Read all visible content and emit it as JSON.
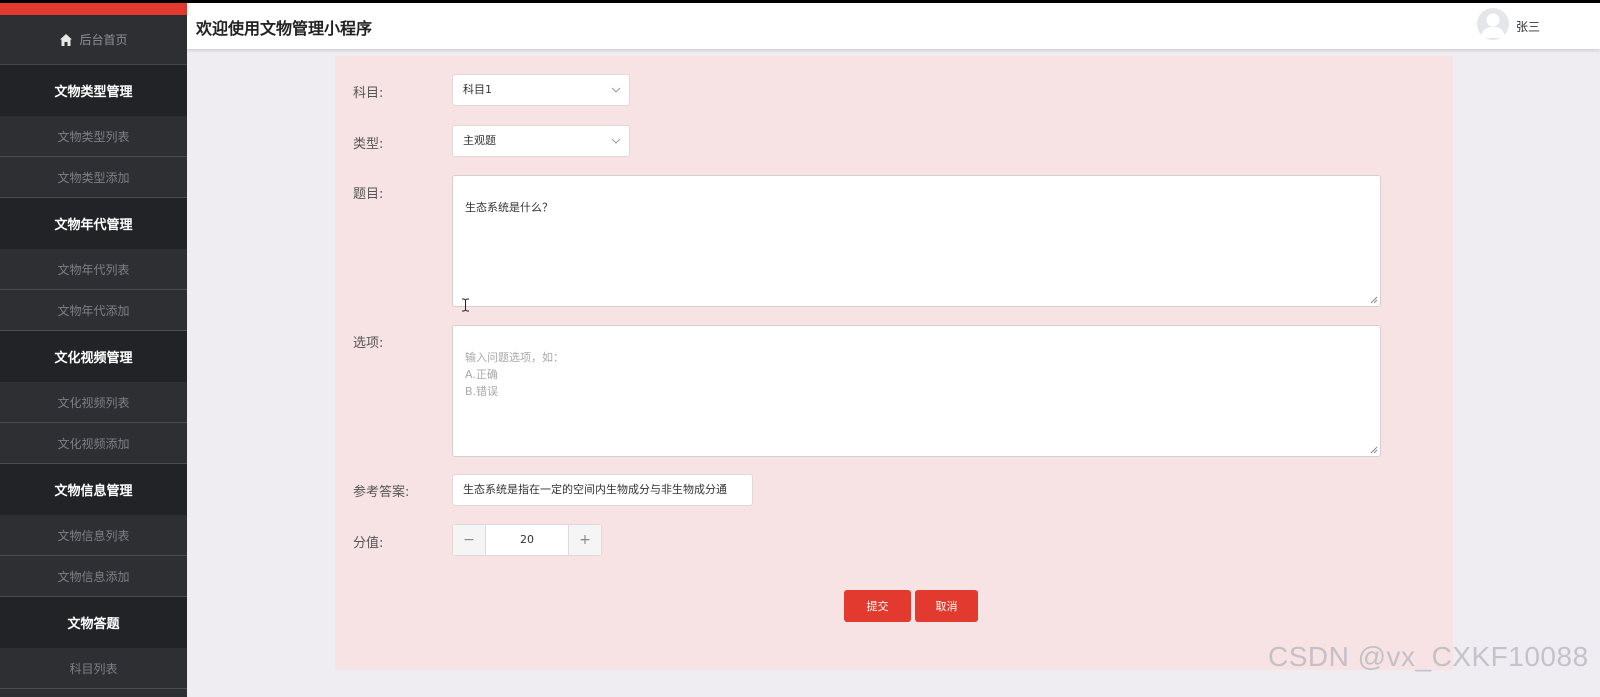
{
  "header": {
    "title": "欢迎使用文物管理小程序",
    "user_name": "张三"
  },
  "sidebar": {
    "home": "后台首页",
    "groups": [
      {
        "title": "文物类型管理",
        "items": [
          "文物类型列表",
          "文物类型添加"
        ]
      },
      {
        "title": "文物年代管理",
        "items": [
          "文物年代列表",
          "文物年代添加"
        ]
      },
      {
        "title": "文化视频管理",
        "items": [
          "文化视频列表",
          "文化视频添加"
        ]
      },
      {
        "title": "文物信息管理",
        "items": [
          "文物信息列表",
          "文物信息添加"
        ]
      },
      {
        "title": "文物答题",
        "items": [
          "科目列表"
        ]
      }
    ]
  },
  "form": {
    "subject_label": "科目:",
    "subject_value": "科目1",
    "type_label": "类型:",
    "type_value": "主观题",
    "question_label": "题目:",
    "question_value": "生态系统是什么？",
    "options_label": "选项:",
    "options_placeholder": "输入问题选项，如：\nA.正确\nB.错误",
    "answer_label": "参考答案:",
    "answer_value": "生态系统是指在一定的空间内生物成分与非生物成分通",
    "score_label": "分值:",
    "score_value": "20",
    "minus": "−",
    "plus": "+",
    "submit": "提交",
    "cancel": "取消"
  },
  "watermark": "CSDN @vx_CXKF10088",
  "colors": {
    "accent": "#e23a2e",
    "sidebar_bg": "#2d2f33",
    "panel_bg": "#f7e3e3"
  }
}
